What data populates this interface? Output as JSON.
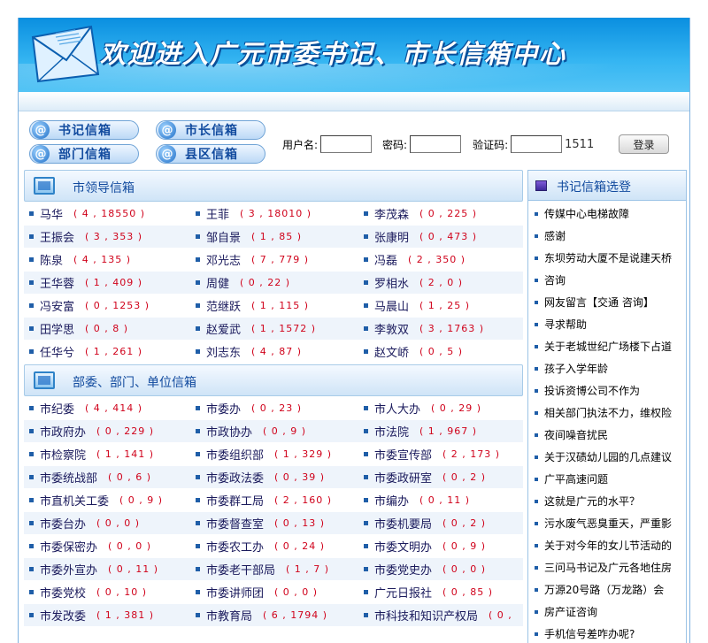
{
  "banner": {
    "title": "欢迎进入广元市委书记、市长信箱中心"
  },
  "nav": {
    "buttons": [
      "书记信箱",
      "市长信箱",
      "部门信箱",
      "县区信箱"
    ],
    "at_symbol": "@"
  },
  "login": {
    "username_label": "用户名:",
    "password_label": "密码:",
    "captcha_label": "验证码:",
    "captcha_value": "1511",
    "submit_label": "登录"
  },
  "leaders": {
    "title": "市领导信箱",
    "items": [
      {
        "name": "马华",
        "count": "( 4 , 18550 )"
      },
      {
        "name": "王菲",
        "count": "( 3 , 18010 )"
      },
      {
        "name": "李茂森",
        "count": "( 0 , 225 )"
      },
      {
        "name": "王振会",
        "count": "( 3 , 353 )"
      },
      {
        "name": "邹自景",
        "count": "( 1 , 85 )"
      },
      {
        "name": "张康明",
        "count": "( 0 , 473 )"
      },
      {
        "name": "陈泉",
        "count": "( 4 , 135 )"
      },
      {
        "name": "邓光志",
        "count": "( 7 , 779 )"
      },
      {
        "name": "冯磊",
        "count": "( 2 , 350 )"
      },
      {
        "name": "王华蓉",
        "count": "( 1 , 409 )"
      },
      {
        "name": "周健",
        "count": "( 0 , 22 )"
      },
      {
        "name": "罗相水",
        "count": "( 2 , 0 )"
      },
      {
        "name": "冯安富",
        "count": "( 0 , 1253 )"
      },
      {
        "name": "范继跃",
        "count": "( 1 , 115 )"
      },
      {
        "name": "马晨山",
        "count": "( 1 , 25 )"
      },
      {
        "name": "田学思",
        "count": "( 0 , 8 )"
      },
      {
        "name": "赵爱武",
        "count": "( 1 , 1572 )"
      },
      {
        "name": "李敦双",
        "count": "( 3 , 1763 )"
      },
      {
        "name": "任华兮",
        "count": "( 1 , 261 )"
      },
      {
        "name": "刘志东",
        "count": "( 4 , 87 )"
      },
      {
        "name": "赵文峤",
        "count": "( 0 , 5 )"
      }
    ]
  },
  "departments": {
    "title": "部委、部门、单位信箱",
    "items": [
      {
        "name": "市纪委",
        "count": "( 4 , 414 )"
      },
      {
        "name": "市委办",
        "count": "( 0 , 23 )"
      },
      {
        "name": "市人大办",
        "count": "( 0 , 29 )"
      },
      {
        "name": "市政府办",
        "count": "( 0 , 229 )"
      },
      {
        "name": "市政协办",
        "count": "( 0 , 9 )"
      },
      {
        "name": "市法院",
        "count": "( 1 , 967 )"
      },
      {
        "name": "市检察院",
        "count": "( 1 , 141 )"
      },
      {
        "name": "市委组织部",
        "count": "( 1 , 329 )"
      },
      {
        "name": "市委宣传部",
        "count": "( 2 , 173 )"
      },
      {
        "name": "市委统战部",
        "count": "( 0 , 6 )"
      },
      {
        "name": "市委政法委",
        "count": "( 0 , 39 )"
      },
      {
        "name": "市委政研室",
        "count": "( 0 , 2 )"
      },
      {
        "name": "市直机关工委",
        "count": "( 0 , 9 )"
      },
      {
        "name": "市委群工局",
        "count": "( 2 , 160 )"
      },
      {
        "name": "市编办",
        "count": "( 0 , 11 )"
      },
      {
        "name": "市委台办",
        "count": "( 0 , 0 )"
      },
      {
        "name": "市委督查室",
        "count": "( 0 , 13 )"
      },
      {
        "name": "市委机要局",
        "count": "( 0 , 2 )"
      },
      {
        "name": "市委保密办",
        "count": "( 0 , 0 )"
      },
      {
        "name": "市委农工办",
        "count": "( 0 , 24 )"
      },
      {
        "name": "市委文明办",
        "count": "( 0 , 9 )"
      },
      {
        "name": "市委外宣办",
        "count": "( 0 , 11 )"
      },
      {
        "name": "市委老干部局",
        "count": "( 1 , 7 )"
      },
      {
        "name": "市委党史办",
        "count": "( 0 , 0 )"
      },
      {
        "name": "市委党校",
        "count": "( 0 , 10 )"
      },
      {
        "name": "市委讲师团",
        "count": "( 0 , 0 )"
      },
      {
        "name": "广元日报社",
        "count": "( 0 , 85 )"
      },
      {
        "name": "市发改委",
        "count": "( 1 , 381 )"
      },
      {
        "name": "市教育局",
        "count": "( 6 , 1794 )"
      },
      {
        "name": "市科技和知识产权局",
        "count": "( 0 ,"
      }
    ]
  },
  "sidebar": {
    "title": "书记信箱选登",
    "items": [
      "传媒中心电梯故障",
      "感谢",
      "东坝劳动大厦不是说建天桥",
      "咨询",
      "网友留言【交通 咨询】",
      "寻求帮助",
      "关于老城世纪广场楼下占道",
      "孩子入学年龄",
      "投诉资博公司不作为",
      "相关部门执法不力，维权险",
      "夜间噪音扰民",
      "关于汉碛幼儿园的几点建议",
      "广平高速问题",
      "这就是广元的水平？",
      "污水废气恶臭重天，严重影",
      "关于对今年的女儿节活动的",
      "三问马书记及广元各地住房",
      "万源20号路（万龙路）会",
      "房产证咨询",
      "手机信号差咋办呢?"
    ]
  }
}
